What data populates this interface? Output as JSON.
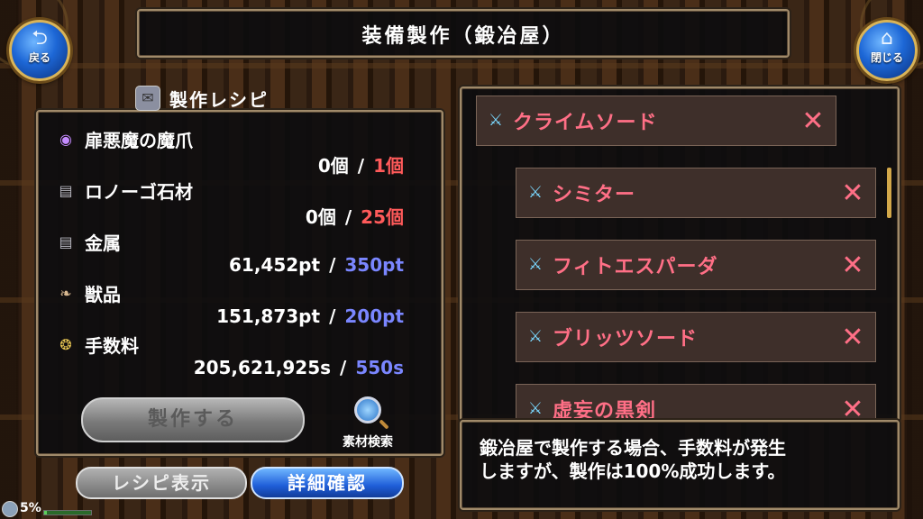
{
  "header": {
    "title": "装備製作（鍛冶屋）",
    "back_label": "戻る",
    "close_label": "閉じる"
  },
  "recipe": {
    "heading": "製作レシピ",
    "materials": [
      {
        "name": "扉悪魔の魔爪",
        "icon": "purple-orb-icon",
        "owned": "0個",
        "separator": "/",
        "required": "1個",
        "required_color": "#ff5a5a"
      },
      {
        "name": "ロノーゴ石材",
        "icon": "stone-block-icon",
        "owned": "0個",
        "separator": "/",
        "required": "25個",
        "required_color": "#ff5a5a"
      },
      {
        "name": "金属",
        "icon": "metal-ingot-icon",
        "owned": "61,452pt",
        "separator": "/",
        "required": "350pt",
        "required_color": "#7a86ff"
      },
      {
        "name": "獣品",
        "icon": "claw-icon",
        "owned": "151,873pt",
        "separator": "/",
        "required": "200pt",
        "required_color": "#7a86ff"
      },
      {
        "name": "手数料",
        "icon": "coins-icon",
        "owned": "205,621,925s",
        "separator": "/",
        "required": "550s",
        "required_color": "#7a86ff"
      }
    ],
    "craft_label": "製作する",
    "search_label": "素材検索",
    "recipe_view_label": "レシピ表示",
    "detail_label": "詳細確認"
  },
  "items": [
    {
      "name": "クライムソード",
      "icon": "sword-icon",
      "mark": "✕"
    },
    {
      "name": "シミター",
      "icon": "sword-icon",
      "mark": "✕"
    },
    {
      "name": "フィトエスパーダ",
      "icon": "sword-icon",
      "mark": "✕"
    },
    {
      "name": "ブリッツソード",
      "icon": "sword-icon",
      "mark": "✕"
    },
    {
      "name": "虚妄の黒剣",
      "icon": "sword-icon",
      "mark": "✕"
    }
  ],
  "info": {
    "line1": "鍛冶屋で製作する場合、手数料が発生",
    "line2": "しますが、製作は100%成功します。"
  },
  "status": {
    "percent_label": "5%",
    "progress": 0.05
  }
}
